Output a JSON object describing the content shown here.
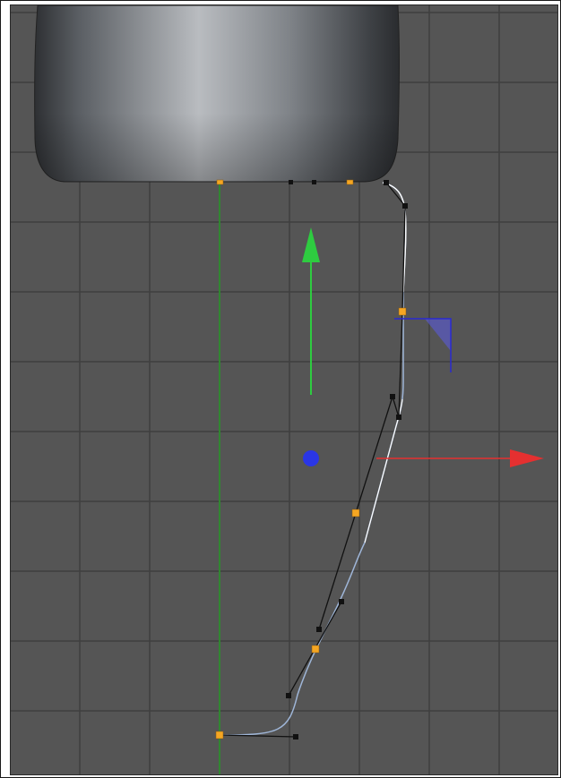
{
  "viewport": {
    "background": "#555555",
    "grid_color": "#3f3f3f",
    "grid_visible": true
  },
  "axis_colors": {
    "y": "#2ecc40",
    "x": "#e53030",
    "z": "#3030e0",
    "symmetry_axis": "#2a9a2a"
  },
  "point_colors": {
    "selected": "#f5a623",
    "tangent_handle": "#111111"
  },
  "spline_colors": {
    "curve": "#9fb6d8",
    "highlight": "#ffffff"
  },
  "icons": [
    "move-y-arrow-icon",
    "move-x-arrow-icon",
    "move-z-dot-icon",
    "rotation-plane-icon"
  ]
}
